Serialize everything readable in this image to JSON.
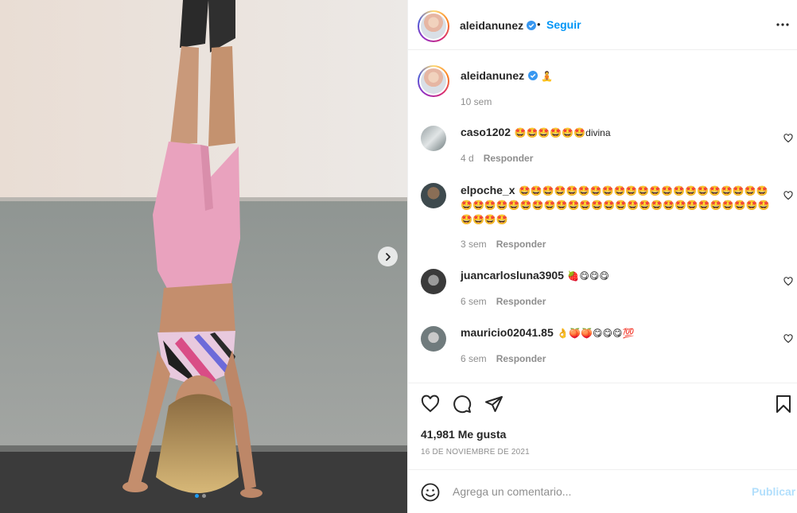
{
  "post": {
    "username": "aleidanunez",
    "follow_label": "Seguir",
    "separator": "•"
  },
  "caption": {
    "username": "aleidanunez",
    "emoji": "🧘",
    "time": "10 sem"
  },
  "comments": [
    {
      "username": "caso1202",
      "text": "🤩🤩🤩🤩🤩🤩divina",
      "time": "4 d",
      "reply": "Responder"
    },
    {
      "username": "elpoche_x",
      "text": "🤩🤩🤩🤩🤩🤩🤩🤩🤩🤩🤩🤩🤩🤩🤩🤩🤩🤩🤩🤩🤩🤩🤩🤩🤩🤩🤩🤩🤩🤩🤩🤩🤩🤩🤩🤩🤩🤩🤩🤩🤩🤩🤩🤩🤩🤩🤩🤩🤩🤩🤩",
      "time": "3 sem",
      "reply": "Responder"
    },
    {
      "username": "juancarlosluna3905",
      "text": "🍓😋😋😋",
      "time": "6 sem",
      "reply": "Responder"
    },
    {
      "username": "mauricio02041.85",
      "text": "👌🍑🍑😋😋😋💯",
      "time": "6 sem",
      "reply": "Responder"
    }
  ],
  "stats": {
    "likes": "41,981 Me gusta",
    "date": "16 DE NOVIEMBRE DE 2021"
  },
  "composer": {
    "placeholder": "Agrega un comentario...",
    "publish_label": "Publicar"
  },
  "carousel": {
    "current": 1,
    "total": 2
  },
  "icons": [
    "verified-badge-icon",
    "more-options-icon",
    "chevron-right-icon",
    "heart-icon",
    "comment-icon",
    "share-icon",
    "bookmark-icon",
    "emoji-icon"
  ],
  "colors": {
    "link_blue": "#0095f6",
    "publish_disabled": "#b2dffc",
    "muted": "#8e8e8e",
    "text": "#262626",
    "verified": "#3897f0"
  }
}
